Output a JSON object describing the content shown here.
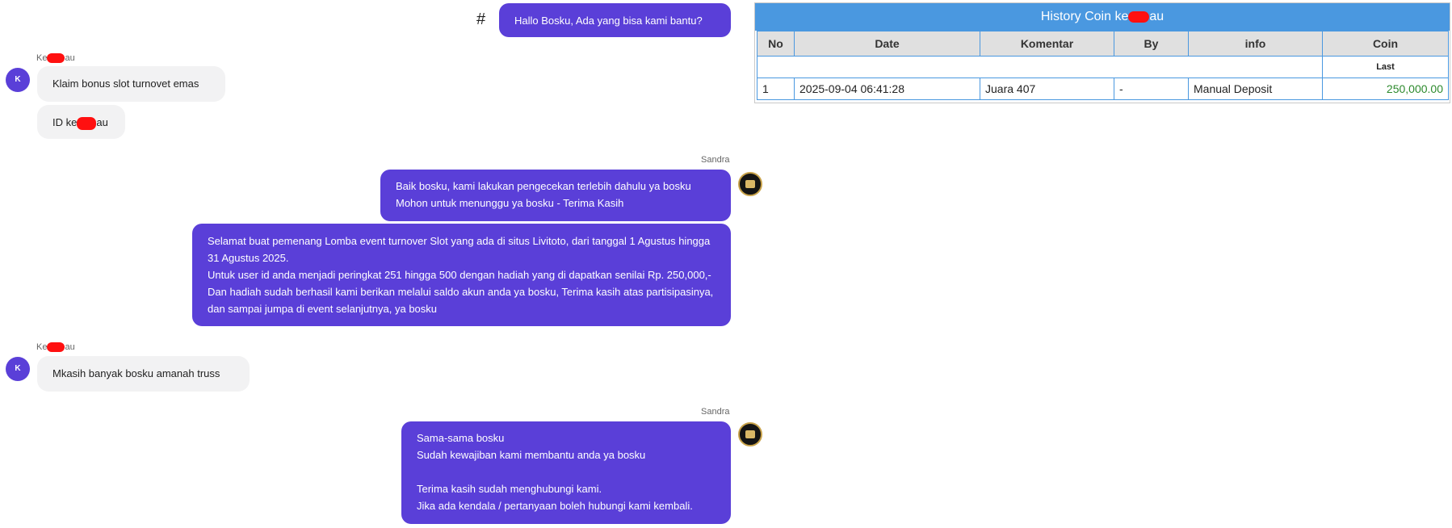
{
  "chat": {
    "greeting": "Hallo Bosku, Ada yang bisa kami bantu?",
    "hash_symbol": "#",
    "agent_name": "Sandra",
    "user_initial": "K",
    "user_name_prefix": "Ke",
    "user_name_suffix": "au",
    "messages": {
      "user_1": "Klaim bonus slot turnovet emas",
      "user_2_prefix": "ID ke",
      "user_2_suffix": "au",
      "agent_1": [
        "Baik bosku, kami lakukan pengecekan terlebih dahulu ya bosku",
        "Mohon untuk menunggu ya bosku - Terima Kasih"
      ],
      "agent_2": "Selamat buat pemenang Lomba event turnover Slot yang ada di situs Livitoto, dari tanggal 1 Agustus hingga 31 Agustus 2025.",
      "agent_2b": "Untuk user id anda menjadi peringkat 251 hingga 500 dengan hadiah yang di dapatkan senilai Rp. 250,000,- Dan hadiah sudah berhasil kami berikan melalui saldo akun anda ya bosku, Terima kasih atas partisipasinya, dan sampai jumpa di event selanjutnya, ya bosku",
      "user_3": "Mkasih banyak bosku amanah truss",
      "agent_3": [
        "Sama-sama bosku",
        "Sudah kewajiban kami membantu anda ya bosku",
        "",
        "Terima kasih sudah menghubungi kami.",
        "Jika ada kendala / pertanyaan boleh hubungi kami kembali."
      ]
    }
  },
  "coin_history": {
    "title_prefix": "History Coin ke",
    "title_suffix": "au",
    "columns": [
      "No",
      "Date",
      "Komentar",
      "By",
      "info",
      "Coin"
    ],
    "subheader_last": "Last",
    "rows": [
      {
        "no": "1",
        "date": "2025-09-04 06:41:28",
        "komentar": "Juara 407",
        "by": "-",
        "info": "Manual Deposit",
        "coin": "250,000.00"
      }
    ]
  },
  "colors": {
    "agent_bubble": "#5a3fd8",
    "user_bubble": "#f2f2f3",
    "table_header": "#4a98e0",
    "coin_value": "#2d8a2d",
    "redaction": "#ff1010"
  }
}
